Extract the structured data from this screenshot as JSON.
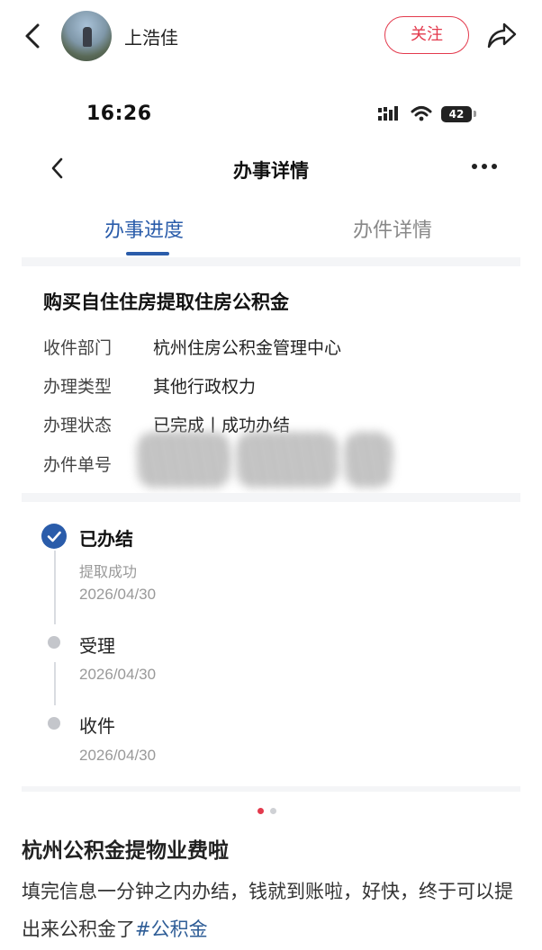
{
  "appbar": {
    "author_name": "上浩佳",
    "follow_label": "关注",
    "accent_color": "#e33a4d"
  },
  "phone": {
    "status_time": "16:26",
    "battery_level": "42",
    "nav_title": "办事详情",
    "tabs": [
      {
        "label": "办事进度",
        "active": true
      },
      {
        "label": "办件详情",
        "active": false
      }
    ],
    "accent_color": "#2a5caa",
    "card": {
      "title": "购买自住住房提取住房公积金",
      "rows": [
        {
          "label": "收件部门",
          "value": "杭州住房公积金管理中心"
        },
        {
          "label": "办理类型",
          "value": "其他行政权力"
        },
        {
          "label": "办理状态",
          "value": "已完成丨成功办结"
        },
        {
          "label": "办件单号",
          "value": ""
        }
      ]
    },
    "timeline": [
      {
        "title": "已办结",
        "subtitle": "提取成功",
        "date": "2026/04/30",
        "done": true
      },
      {
        "title": "受理",
        "subtitle": "",
        "date": "2026/04/30",
        "done": false
      },
      {
        "title": "收件",
        "subtitle": "",
        "date": "2026/04/30",
        "done": false
      }
    ]
  },
  "carousel": {
    "current": 1,
    "total": 2
  },
  "post": {
    "title": "杭州公积金提物业费啦",
    "body": "填完信息一分钟之内办结，钱就到账啦，好快，终于可以提出来公积金了",
    "hashtag": "#公积金"
  }
}
